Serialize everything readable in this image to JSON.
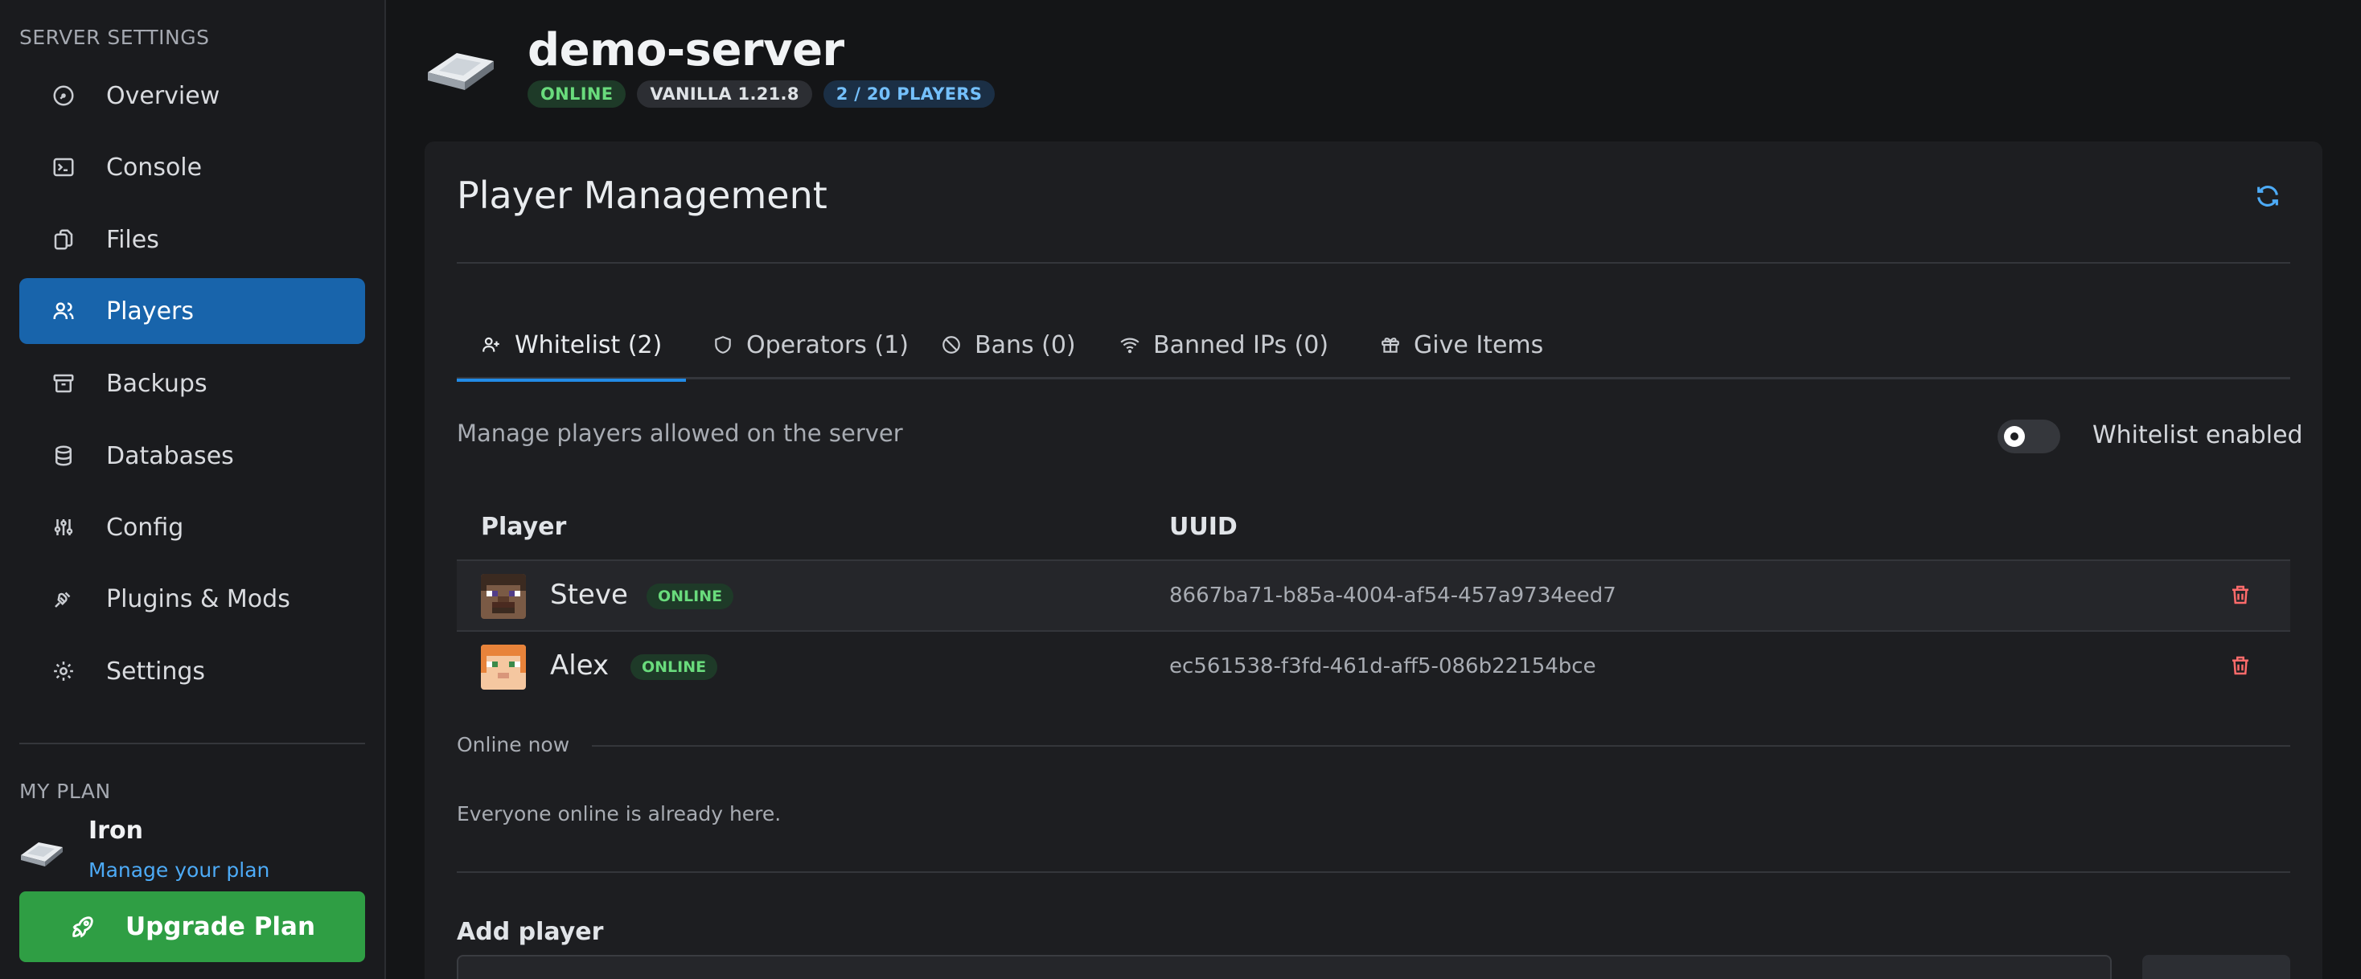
{
  "sidebar": {
    "section_label": "SERVER SETTINGS",
    "items": [
      {
        "label": "Overview",
        "icon": "gauge-icon"
      },
      {
        "label": "Console",
        "icon": "terminal-icon"
      },
      {
        "label": "Files",
        "icon": "files-icon"
      },
      {
        "label": "Players",
        "icon": "users-icon",
        "active": true
      },
      {
        "label": "Backups",
        "icon": "archive-icon"
      },
      {
        "label": "Databases",
        "icon": "database-icon"
      },
      {
        "label": "Config",
        "icon": "sliders-icon"
      },
      {
        "label": "Plugins & Mods",
        "icon": "plug-icon"
      },
      {
        "label": "Settings",
        "icon": "gear-icon"
      }
    ],
    "plan": {
      "section_label": "MY PLAN",
      "name": "Iron",
      "link": "Manage your plan",
      "upgrade_label": "Upgrade Plan"
    }
  },
  "header": {
    "server_name": "demo-server",
    "badges": {
      "status": "ONLINE",
      "version": "VANILLA 1.21.8",
      "players": "2 / 20 PLAYERS"
    }
  },
  "panel": {
    "title": "Player Management",
    "tabs": [
      {
        "label": "Whitelist (2)",
        "icon": "user-plus-icon",
        "active": true
      },
      {
        "label": "Operators (1)",
        "icon": "shield-icon"
      },
      {
        "label": "Bans (0)",
        "icon": "ban-icon"
      },
      {
        "label": "Banned IPs (0)",
        "icon": "wifi-icon"
      },
      {
        "label": "Give Items",
        "icon": "gift-icon"
      }
    ],
    "description": "Manage players allowed on the server",
    "toggle_label": "Whitelist enabled",
    "table": {
      "headers": {
        "player": "Player",
        "uuid": "UUID"
      },
      "rows": [
        {
          "name": "Steve",
          "status": "ONLINE",
          "uuid": "8667ba71-b85a-4004-af54-457a9734eed7"
        },
        {
          "name": "Alex",
          "status": "ONLINE",
          "uuid": "ec561538-f3fd-461d-aff5-086b22154bce"
        }
      ]
    },
    "online_now": {
      "label": "Online now",
      "empty_text": "Everyone online is already here."
    },
    "add_player": {
      "title": "Add player"
    }
  },
  "colors": {
    "accent": "#1864ab",
    "success": "#2f9e44",
    "danger": "#e03131",
    "link": "#4dabf7"
  }
}
